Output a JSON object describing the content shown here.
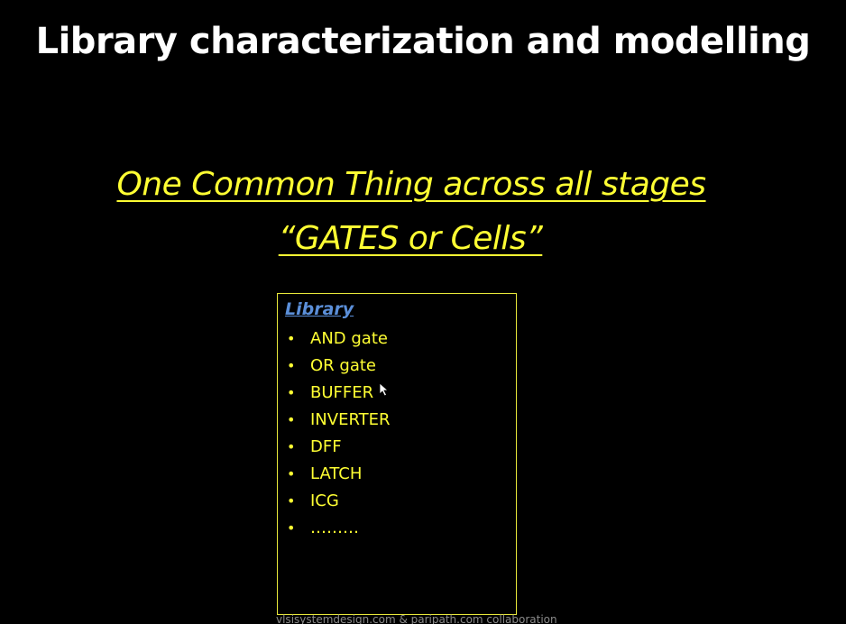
{
  "slide": {
    "title": "Library characterization and modelling",
    "subtitle_line1": "One Common Thing across all stages",
    "subtitle_line2": "“GATES or Cells”",
    "library": {
      "heading": "Library",
      "items": [
        {
          "bullet": "•",
          "label": "AND gate"
        },
        {
          "bullet": "•",
          "label": "OR gate"
        },
        {
          "bullet": "•",
          "label": "BUFFER"
        },
        {
          "bullet": "•",
          "label": "INVERTER"
        },
        {
          "bullet": "•",
          "label": "DFF"
        },
        {
          "bullet": "•",
          "label": "LATCH"
        },
        {
          "bullet": "•",
          "label": "ICG"
        },
        {
          "bullet": "•",
          "label": "………"
        }
      ]
    },
    "watermark": "vlsisystemdesign.com & paripath.com collaboration"
  },
  "colors": {
    "background": "#000000",
    "title": "#ffffff",
    "accent_yellow": "#ffff33",
    "heading_blue": "#5b8fd9",
    "box_border": "#e8e83a"
  },
  "icons": {
    "pointer": "mouse-pointer-icon"
  }
}
